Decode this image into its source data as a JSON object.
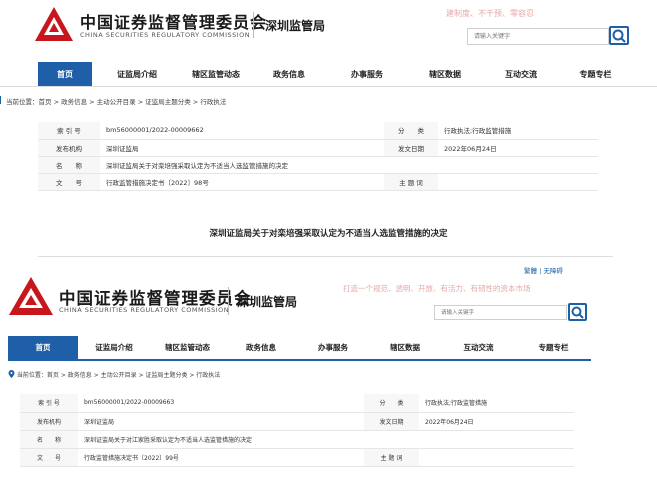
{
  "colors": {
    "accent": "#1e5fa8",
    "brand_red": "#c8161d",
    "slogan": "#e3a8a8"
  },
  "icons": {
    "logo": "csrc-emblem-icon",
    "search": "search-icon",
    "location": "location-pin-icon"
  },
  "header": {
    "cn_name": "中国证券监督管理委员会",
    "en_name": "CHINA SECURITIES REGULATORY COMMISSION",
    "bureau": "深圳监管局",
    "slogan_1": "建制度、不干预、零容忍",
    "slogan_2": "打造一个规范、透明、开放、有活力、有韧性的资本市场",
    "search_placeholder": "请输入关键字",
    "toplinks": "繁體 | 无障碍"
  },
  "nav": [
    "首页",
    "证监局介绍",
    "辖区监管动态",
    "政务信息",
    "办事服务",
    "辖区数据",
    "互动交流",
    "专题专栏"
  ],
  "nav_active": "首页",
  "doc1": {
    "breadcrumb": "当前位置：首页 > 政务信息 > 主动公开目录 > 证监局主题分类 > 行政执法",
    "rows": [
      {
        "k1": "索 引 号",
        "v1": "bm56000001/2022-00009662",
        "k2": "分　　类",
        "v2": "行政执法;行政监管措施"
      },
      {
        "k1": "发布机构",
        "v1": "深圳证监局",
        "k2": "发文日期",
        "v2": "2022年06月24日"
      },
      {
        "k1": "名　　称",
        "v1": "深圳证监局关于对栾培强采取认定为不适当人选监管措施的决定",
        "k2": "",
        "v2": ""
      },
      {
        "k1": "文　　号",
        "v1": "行政监管措施决定书〔2022〕98号",
        "k2": "主 题 词",
        "v2": ""
      }
    ],
    "title": "深圳证监局关于对栾培强采取认定为不适当人选监管措施的决定"
  },
  "doc2": {
    "breadcrumb": "当前位置：首页 > 政务信息 > 主动公开目录 > 证监局主题分类 > 行政执法",
    "rows": [
      {
        "k1": "索 引 号",
        "v1": "bm56000001/2022-00009663",
        "k2": "分　　类",
        "v2": "行政执法;行政监管措施"
      },
      {
        "k1": "发布机构",
        "v1": "深圳证监局",
        "k2": "发文日期",
        "v2": "2022年06月24日"
      },
      {
        "k1": "名　　称",
        "v1": "深圳证监局关于对江家胜采取认定为不适当人选监管措施的决定",
        "k2": "",
        "v2": ""
      },
      {
        "k1": "文　　号",
        "v1": "行政监管措施决定书〔2022〕99号",
        "k2": "主 题 词",
        "v2": ""
      }
    ]
  }
}
